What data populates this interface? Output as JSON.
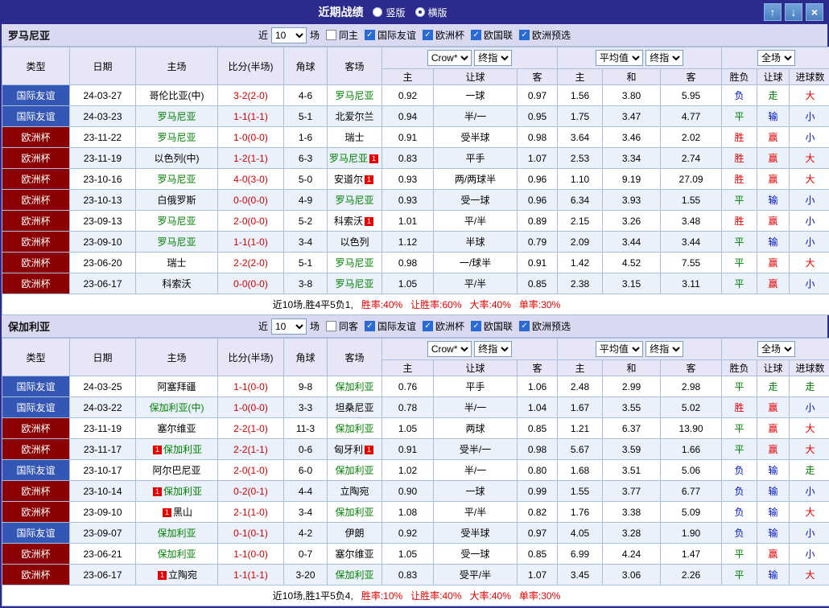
{
  "palette": {
    "titlebar_bg": "#2b2b8e",
    "window_button_bg": "#4a7fc1",
    "section_header_bg": "#d9d9f2",
    "table_header_bg": "#e6e6f7",
    "grid_border": "#a9c0dd",
    "row_alt_bg": "#eaf1fa",
    "self_team_color": "#008000",
    "score_color": "#d00000",
    "win_color": "#e60000",
    "draw_color": "#008000",
    "loss_color": "#0011cc",
    "red_card_badge": "#e60000",
    "checkbox_checked": "#2a6ad4"
  },
  "titlebar": {
    "title": "近期战绩",
    "radios": [
      {
        "label": "竖版",
        "selected": false
      },
      {
        "label": "横版",
        "selected": true
      }
    ],
    "buttons": {
      "up": "↑",
      "down": "↓",
      "close": "×"
    }
  },
  "filter": {
    "near": "近",
    "count": "10",
    "matches": "场",
    "competitions": [
      "国际友谊",
      "欧洲杯",
      "欧国联",
      "欧洲预选"
    ]
  },
  "table_header": {
    "type": "类型",
    "date": "日期",
    "home": "主场",
    "score": "比分(半场)",
    "corner": "角球",
    "away": "客场",
    "odds_source": "Crow*",
    "odds_kind": "终指",
    "avg_source": "平均值",
    "avg_kind": "终指",
    "scope": "全场",
    "sub": [
      "主",
      "让球",
      "客",
      "主",
      "和",
      "客",
      "胜负",
      "让球",
      "进球数"
    ]
  },
  "type_colors": {
    "国际友谊": "#3456b4",
    "欧洲杯": "#8b0000"
  },
  "sections": [
    {
      "team": "罗马尼亚",
      "same_label": "同主",
      "rows": [
        {
          "type": "国际友谊",
          "date": "24-03-27",
          "home": "哥伦比亚(中)",
          "hs": false,
          "hc": 0,
          "score": "3-2(2-0)",
          "corner": "4-6",
          "away": "罗马尼亚",
          "as": true,
          "ac": 0,
          "odds": [
            "0.92",
            "一球",
            "0.97"
          ],
          "avg": [
            "1.56",
            "3.80",
            "5.95"
          ],
          "res": [
            "负",
            "走",
            "大"
          ]
        },
        {
          "type": "国际友谊",
          "date": "24-03-23",
          "home": "罗马尼亚",
          "hs": true,
          "hc": 0,
          "score": "1-1(1-1)",
          "corner": "5-1",
          "away": "北爱尔兰",
          "as": false,
          "ac": 0,
          "odds": [
            "0.94",
            "半/一",
            "0.95"
          ],
          "avg": [
            "1.75",
            "3.47",
            "4.77"
          ],
          "res": [
            "平",
            "输",
            "小"
          ]
        },
        {
          "type": "欧洲杯",
          "date": "23-11-22",
          "home": "罗马尼亚",
          "hs": true,
          "hc": 0,
          "score": "1-0(0-0)",
          "corner": "1-6",
          "away": "瑞士",
          "as": false,
          "ac": 0,
          "odds": [
            "0.91",
            "受半球",
            "0.98"
          ],
          "avg": [
            "3.64",
            "3.46",
            "2.02"
          ],
          "res": [
            "胜",
            "赢",
            "小"
          ]
        },
        {
          "type": "欧洲杯",
          "date": "23-11-19",
          "home": "以色列(中)",
          "hs": false,
          "hc": 0,
          "score": "1-2(1-1)",
          "corner": "6-3",
          "away": "罗马尼亚",
          "as": true,
          "ac": 1,
          "odds": [
            "0.83",
            "平手",
            "1.07"
          ],
          "avg": [
            "2.53",
            "3.34",
            "2.74"
          ],
          "res": [
            "胜",
            "赢",
            "大"
          ]
        },
        {
          "type": "欧洲杯",
          "date": "23-10-16",
          "home": "罗马尼亚",
          "hs": true,
          "hc": 0,
          "score": "4-0(3-0)",
          "corner": "5-0",
          "away": "安道尔",
          "as": false,
          "ac": 1,
          "odds": [
            "0.93",
            "两/两球半",
            "0.96"
          ],
          "avg": [
            "1.10",
            "9.19",
            "27.09"
          ],
          "res": [
            "胜",
            "赢",
            "大"
          ]
        },
        {
          "type": "欧洲杯",
          "date": "23-10-13",
          "home": "白俄罗斯",
          "hs": false,
          "hc": 0,
          "score": "0-0(0-0)",
          "corner": "4-9",
          "away": "罗马尼亚",
          "as": true,
          "ac": 0,
          "odds": [
            "0.93",
            "受一球",
            "0.96"
          ],
          "avg": [
            "6.34",
            "3.93",
            "1.55"
          ],
          "res": [
            "平",
            "输",
            "小"
          ]
        },
        {
          "type": "欧洲杯",
          "date": "23-09-13",
          "home": "罗马尼亚",
          "hs": true,
          "hc": 0,
          "score": "2-0(0-0)",
          "corner": "5-2",
          "away": "科索沃",
          "as": false,
          "ac": 1,
          "odds": [
            "1.01",
            "平/半",
            "0.89"
          ],
          "avg": [
            "2.15",
            "3.26",
            "3.48"
          ],
          "res": [
            "胜",
            "赢",
            "小"
          ]
        },
        {
          "type": "欧洲杯",
          "date": "23-09-10",
          "home": "罗马尼亚",
          "hs": true,
          "hc": 0,
          "score": "1-1(1-0)",
          "corner": "3-4",
          "away": "以色列",
          "as": false,
          "ac": 0,
          "odds": [
            "1.12",
            "半球",
            "0.79"
          ],
          "avg": [
            "2.09",
            "3.44",
            "3.44"
          ],
          "res": [
            "平",
            "输",
            "小"
          ]
        },
        {
          "type": "欧洲杯",
          "date": "23-06-20",
          "home": "瑞士",
          "hs": false,
          "hc": 0,
          "score": "2-2(2-0)",
          "corner": "5-1",
          "away": "罗马尼亚",
          "as": true,
          "ac": 0,
          "odds": [
            "0.98",
            "一/球半",
            "0.91"
          ],
          "avg": [
            "1.42",
            "4.52",
            "7.55"
          ],
          "res": [
            "平",
            "赢",
            "大"
          ]
        },
        {
          "type": "欧洲杯",
          "date": "23-06-17",
          "home": "科索沃",
          "hs": false,
          "hc": 0,
          "score": "0-0(0-0)",
          "corner": "3-8",
          "away": "罗马尼亚",
          "as": true,
          "ac": 0,
          "odds": [
            "1.05",
            "平/半",
            "0.85"
          ],
          "avg": [
            "2.38",
            "3.15",
            "3.11"
          ],
          "res": [
            "平",
            "赢",
            "小"
          ]
        }
      ],
      "footer": {
        "summary": "近10场,胜4平5负1,",
        "stats": [
          "胜率:40%",
          "让胜率:60%",
          "大率:40%",
          "单率:30%"
        ]
      }
    },
    {
      "team": "保加利亚",
      "same_label": "同客",
      "rows": [
        {
          "type": "国际友谊",
          "date": "24-03-25",
          "home": "阿塞拜疆",
          "hs": false,
          "hc": 0,
          "score": "1-1(0-0)",
          "corner": "9-8",
          "away": "保加利亚",
          "as": true,
          "ac": 0,
          "odds": [
            "0.76",
            "平手",
            "1.06"
          ],
          "avg": [
            "2.48",
            "2.99",
            "2.98"
          ],
          "res": [
            "平",
            "走",
            "走"
          ]
        },
        {
          "type": "国际友谊",
          "date": "24-03-22",
          "home": "保加利亚(中)",
          "hs": true,
          "hc": 0,
          "score": "1-0(0-0)",
          "corner": "3-3",
          "away": "坦桑尼亚",
          "as": false,
          "ac": 0,
          "odds": [
            "0.78",
            "半/一",
            "1.04"
          ],
          "avg": [
            "1.67",
            "3.55",
            "5.02"
          ],
          "res": [
            "胜",
            "赢",
            "小"
          ]
        },
        {
          "type": "欧洲杯",
          "date": "23-11-19",
          "home": "塞尔维亚",
          "hs": false,
          "hc": 0,
          "score": "2-2(1-0)",
          "corner": "11-3",
          "away": "保加利亚",
          "as": true,
          "ac": 0,
          "odds": [
            "1.05",
            "两球",
            "0.85"
          ],
          "avg": [
            "1.21",
            "6.37",
            "13.90"
          ],
          "res": [
            "平",
            "赢",
            "大"
          ]
        },
        {
          "type": "欧洲杯",
          "date": "23-11-17",
          "home": "保加利亚",
          "hs": true,
          "hc": 1,
          "score": "2-2(1-1)",
          "corner": "0-6",
          "away": "匈牙利",
          "as": false,
          "ac": 1,
          "odds": [
            "0.91",
            "受半/一",
            "0.98"
          ],
          "avg": [
            "5.67",
            "3.59",
            "1.66"
          ],
          "res": [
            "平",
            "赢",
            "大"
          ]
        },
        {
          "type": "国际友谊",
          "date": "23-10-17",
          "home": "阿尔巴尼亚",
          "hs": false,
          "hc": 0,
          "score": "2-0(1-0)",
          "corner": "6-0",
          "away": "保加利亚",
          "as": true,
          "ac": 0,
          "odds": [
            "1.02",
            "半/一",
            "0.80"
          ],
          "avg": [
            "1.68",
            "3.51",
            "5.06"
          ],
          "res": [
            "负",
            "输",
            "走"
          ]
        },
        {
          "type": "欧洲杯",
          "date": "23-10-14",
          "home": "保加利亚",
          "hs": true,
          "hc": 1,
          "score": "0-2(0-1)",
          "corner": "4-4",
          "away": "立陶宛",
          "as": false,
          "ac": 0,
          "odds": [
            "0.90",
            "一球",
            "0.99"
          ],
          "avg": [
            "1.55",
            "3.77",
            "6.77"
          ],
          "res": [
            "负",
            "输",
            "小"
          ]
        },
        {
          "type": "欧洲杯",
          "date": "23-09-10",
          "home": "黑山",
          "hs": false,
          "hc": 1,
          "score": "2-1(1-0)",
          "corner": "3-4",
          "away": "保加利亚",
          "as": true,
          "ac": 0,
          "odds": [
            "1.08",
            "平/半",
            "0.82"
          ],
          "avg": [
            "1.76",
            "3.38",
            "5.09"
          ],
          "res": [
            "负",
            "输",
            "大"
          ]
        },
        {
          "type": "国际友谊",
          "date": "23-09-07",
          "home": "保加利亚",
          "hs": true,
          "hc": 0,
          "score": "0-1(0-1)",
          "corner": "4-2",
          "away": "伊朗",
          "as": false,
          "ac": 0,
          "odds": [
            "0.92",
            "受半球",
            "0.97"
          ],
          "avg": [
            "4.05",
            "3.28",
            "1.90"
          ],
          "res": [
            "负",
            "输",
            "小"
          ]
        },
        {
          "type": "欧洲杯",
          "date": "23-06-21",
          "home": "保加利亚",
          "hs": true,
          "hc": 0,
          "score": "1-1(0-0)",
          "corner": "0-7",
          "away": "塞尔维亚",
          "as": false,
          "ac": 0,
          "odds": [
            "1.05",
            "受一球",
            "0.85"
          ],
          "avg": [
            "6.99",
            "4.24",
            "1.47"
          ],
          "res": [
            "平",
            "赢",
            "小"
          ]
        },
        {
          "type": "欧洲杯",
          "date": "23-06-17",
          "home": "立陶宛",
          "hs": false,
          "hc": 1,
          "score": "1-1(1-1)",
          "corner": "3-20",
          "away": "保加利亚",
          "as": true,
          "ac": 0,
          "odds": [
            "0.83",
            "受平/半",
            "1.07"
          ],
          "avg": [
            "3.45",
            "3.06",
            "2.26"
          ],
          "res": [
            "平",
            "输",
            "大"
          ]
        }
      ],
      "footer": {
        "summary": "近10场,胜1平5负4,",
        "stats": [
          "胜率:10%",
          "让胜率:40%",
          "大率:40%",
          "单率:30%"
        ]
      }
    }
  ]
}
